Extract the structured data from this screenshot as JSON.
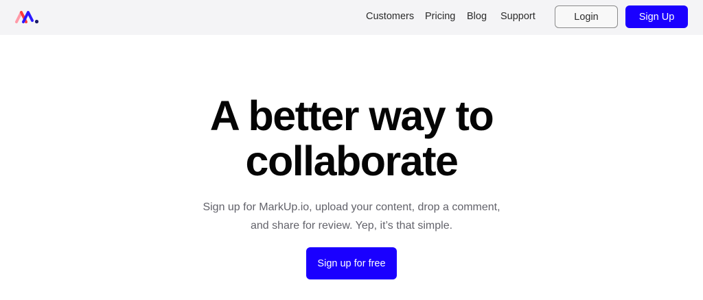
{
  "brand": {
    "logo_icon": "markup-logo-icon",
    "colors": {
      "red": "#ff3b3b",
      "pink": "#ff9aa8",
      "indigo": "#2b1aff",
      "dot": "#1a1a66"
    }
  },
  "nav": {
    "links": [
      "Customers",
      "Pricing",
      "Blog",
      "Support"
    ],
    "login_label": "Login",
    "signup_label": "Sign Up"
  },
  "hero": {
    "title_line1": "A better way to",
    "title_line2": "collaborate",
    "subtitle_line1": "Sign up for MarkUp.io, upload your content, drop a comment,",
    "subtitle_line2": "and share for review. Yep, it’s that simple.",
    "cta_label": "Sign up for free"
  },
  "colors": {
    "accent": "#1a00ff",
    "header_bg": "#f4f4f6",
    "text_muted": "#62626a"
  }
}
